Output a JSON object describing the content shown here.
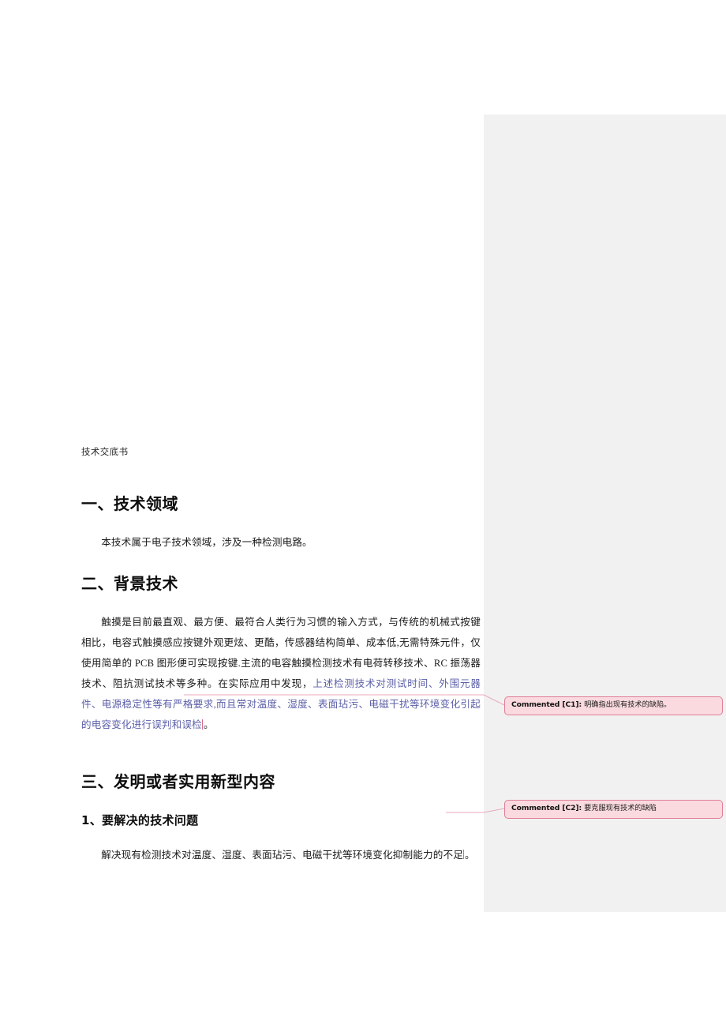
{
  "document": {
    "subtitle": "技术交底书",
    "sections": [
      {
        "heading": "一、技术领域",
        "paragraph": "本技术属于电子技术领域，涉及一种检测电路。"
      },
      {
        "heading": "二、背景技术",
        "paragraph_plain": "触摸是目前最直观、最方便、最符合人类行为习惯的输入方式，与传统的机械式按键相比，电容式触摸感应按键外观更炫、更酷，传感器结构简单、成本低,无需特殊元件，仅使用简单的 PCB 图形便可实现按键.主流的电容触摸检测技术有电荷转移技术、RC 振荡器技术、阻抗测试技术等多种。在实际应用中发现，",
        "paragraph_highlighted": "上述检测技术对测试时间、外围元器件、电源稳定性等有严格要求,而且常对温度、湿度、表面玷污、电磁干扰等环境变化引起的电容变化进行误判和误检",
        "paragraph_tail": "。"
      },
      {
        "heading": "三、发明或者实用新型内容"
      },
      {
        "subheading": "1、要解决的技术问题",
        "paragraph": "解决现有检测技术对温度、湿度、表面玷污、电磁干扰等环境变化抑制能力的不足",
        "paragraph_tail": "。"
      }
    ]
  },
  "comments": [
    {
      "id": "C1",
      "label": "Commented [C1]:",
      "text": "明确指出现有技术的缺陷。"
    },
    {
      "id": "C2",
      "label": "Commented [C2]:",
      "text": "要克服现有技术的缺陷"
    }
  ],
  "colors": {
    "review_pane_bg": "#f1f1f1",
    "comment_bg": "#fadadf",
    "comment_border": "#e07f98",
    "highlight_text": "#5b5fa8",
    "page_bg": "#ffffff"
  }
}
